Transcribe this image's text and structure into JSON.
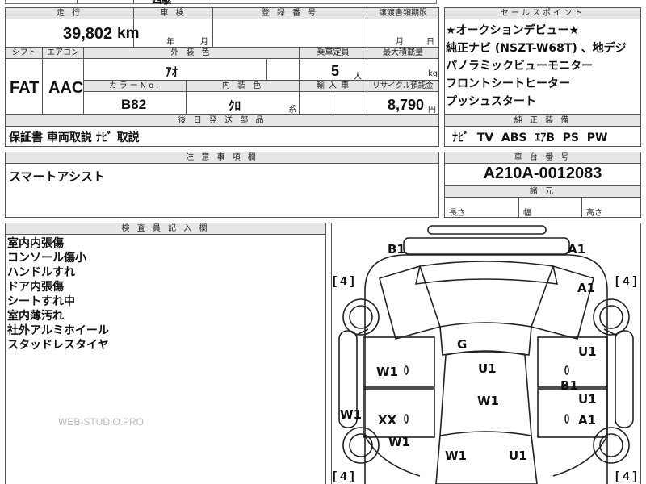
{
  "top_clipped": {
    "text": "四駆"
  },
  "mileage": {
    "label": "走 行",
    "value": "39,802",
    "unit": "km"
  },
  "inspection": {
    "label": "車 検",
    "year_unit": "年",
    "month_unit": "月"
  },
  "registration": {
    "label": "登 録 番 号"
  },
  "transfer_deadline": {
    "label": "譲渡書類期限",
    "month_unit": "月",
    "day_unit": "日"
  },
  "shift": {
    "label": "シフト",
    "value": "FAT"
  },
  "aircon": {
    "label": "エアコン",
    "value": "AAC"
  },
  "exterior_color": {
    "label": "外 装 色",
    "value": "ｱｵ"
  },
  "capacity": {
    "label": "乗車定員",
    "value": "5",
    "unit": "人"
  },
  "max_load": {
    "label": "最大積載量",
    "unit": "kg"
  },
  "color_no": {
    "label": "カラーNo.",
    "value": "B82"
  },
  "interior_color": {
    "label": "内 装 色",
    "value": "ｸﾛ",
    "suffix": "系"
  },
  "import_car": {
    "label": "輸 入 車"
  },
  "recycle": {
    "label": "リサイクル預託金",
    "value": "8,790",
    "unit": "円"
  },
  "later_parts": {
    "label": "後 日 発 送 部 品",
    "value": "保証書 車両取説 ﾅﾋﾞ 取説"
  },
  "sales_points": {
    "label": "セールスポイント",
    "lines": [
      "★オークションデビュー★",
      "純正ナビ (NSZT-W68T) 、地デジ",
      "パノラミックビューモニター",
      "フロントシートヒーター",
      "プッシュスタート"
    ]
  },
  "genuine_equipment": {
    "label": "純 正 装 備",
    "value": "ﾅﾋﾞ  TV  ABS  ｴｱB  PS  PW"
  },
  "caution": {
    "label": "注 意 事 項 欄",
    "value": "スマートアシスト"
  },
  "chassis": {
    "label": "車 台 番 号",
    "value": "A210A-0012083"
  },
  "dimensions": {
    "label": "諸 元",
    "length": "長さ",
    "width": "幅",
    "height": "高さ"
  },
  "inspector": {
    "label": "検 査 員 記 入 欄",
    "lines": [
      "室内内張傷",
      "コンソール傷小",
      "ハンドルすれ",
      "ドア内張傷",
      "シートすれ中",
      "室内薄汚れ",
      "社外アルミホイール",
      "スタッドレスタイヤ"
    ],
    "watermark": "WEB-STUDIO.PRO"
  },
  "diagram": {
    "tire_depth": "[ 4 ]",
    "marks": {
      "b1_top": "B1",
      "a1_top": "A1",
      "a1_right": "A1",
      "g": "G",
      "u1_right": "U1",
      "w1_left": "W1",
      "u1_center": "U1",
      "b1_right": "B1",
      "w1_center": "W1",
      "u1_right2": "U1",
      "w1_farleft": "W1",
      "xx": "XX",
      "a1_right2": "A1",
      "w1_left2": "W1",
      "w1_bottom": "W1",
      "u1_bottom": "U1"
    }
  }
}
